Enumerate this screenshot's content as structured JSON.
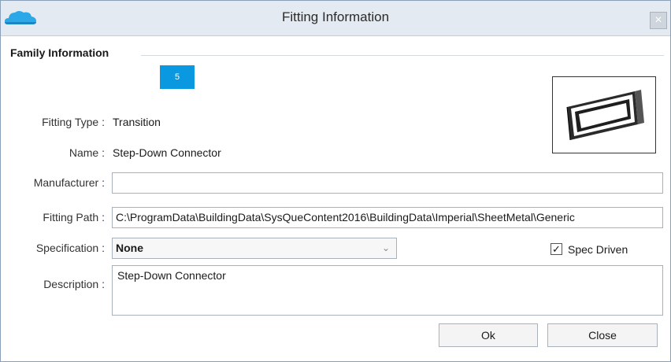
{
  "window": {
    "title": "Fitting Information",
    "close_glyph": "×"
  },
  "family": {
    "group_title": "Family Information",
    "badge": "5",
    "fitting_type_label": "Fitting Type :",
    "fitting_type_value": "Transition",
    "name_label": "Name :",
    "name_value": "Step-Down Connector",
    "manufacturer_label": "Manufacturer :",
    "manufacturer_value": "",
    "fitting_path_label": "Fitting Path :",
    "fitting_path_value": "C:\\ProgramData\\BuildingData\\SysQueContent2016\\BuildingData\\Imperial\\SheetMetal\\Generic",
    "specification_label": "Specification :",
    "specification_value": "None",
    "spec_driven_label": "Spec Driven",
    "spec_driven_checked": true,
    "description_label": "Description :",
    "description_value": "Step-Down Connector"
  },
  "buttons": {
    "ok": "Ok",
    "close": "Close"
  },
  "icons": {
    "app": "cloud-icon",
    "close": "close-icon",
    "dropdown": "chevron-down-icon",
    "check": "checkmark-icon"
  },
  "colors": {
    "badge": "#0a99e0",
    "titlebar": "#e4eaf1",
    "app_icon": "#2aa8e8"
  }
}
